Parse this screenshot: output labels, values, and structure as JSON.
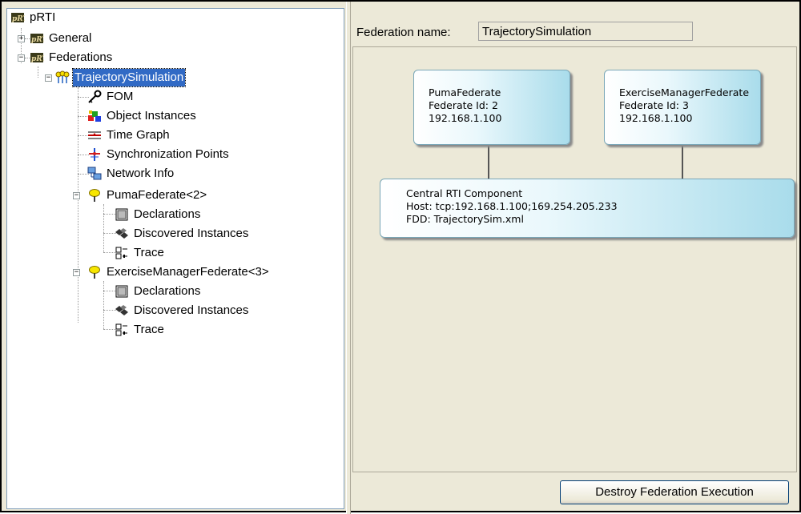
{
  "tree": {
    "root": "pRTI",
    "general": "General",
    "federations": "Federations",
    "federation": "TrajectorySimulation",
    "fom": "FOM",
    "object_instances": "Object Instances",
    "time_graph": "Time Graph",
    "sync_points": "Synchronization Points",
    "network_info": "Network Info",
    "federate1": "PumaFederate<2>",
    "federate2": "ExerciseManagerFederate<3>",
    "declarations": "Declarations",
    "discovered_instances": "Discovered Instances",
    "trace": "Trace"
  },
  "federation_name_label": "Federation name:",
  "federation_name_value": "TrajectorySimulation",
  "federates": [
    {
      "name": "PumaFederate",
      "id_line": "Federate Id: 2",
      "ip": "192.168.1.100"
    },
    {
      "name": "ExerciseManagerFederate",
      "id_line": "Federate Id: 3",
      "ip": "192.168.1.100"
    }
  ],
  "rti": {
    "title": "Central RTI Component",
    "host": "Host: tcp:192.168.1.100;169.254.205.233",
    "fdd": "FDD: TrajectorySim.xml"
  },
  "destroy_button": "Destroy Federation Execution"
}
